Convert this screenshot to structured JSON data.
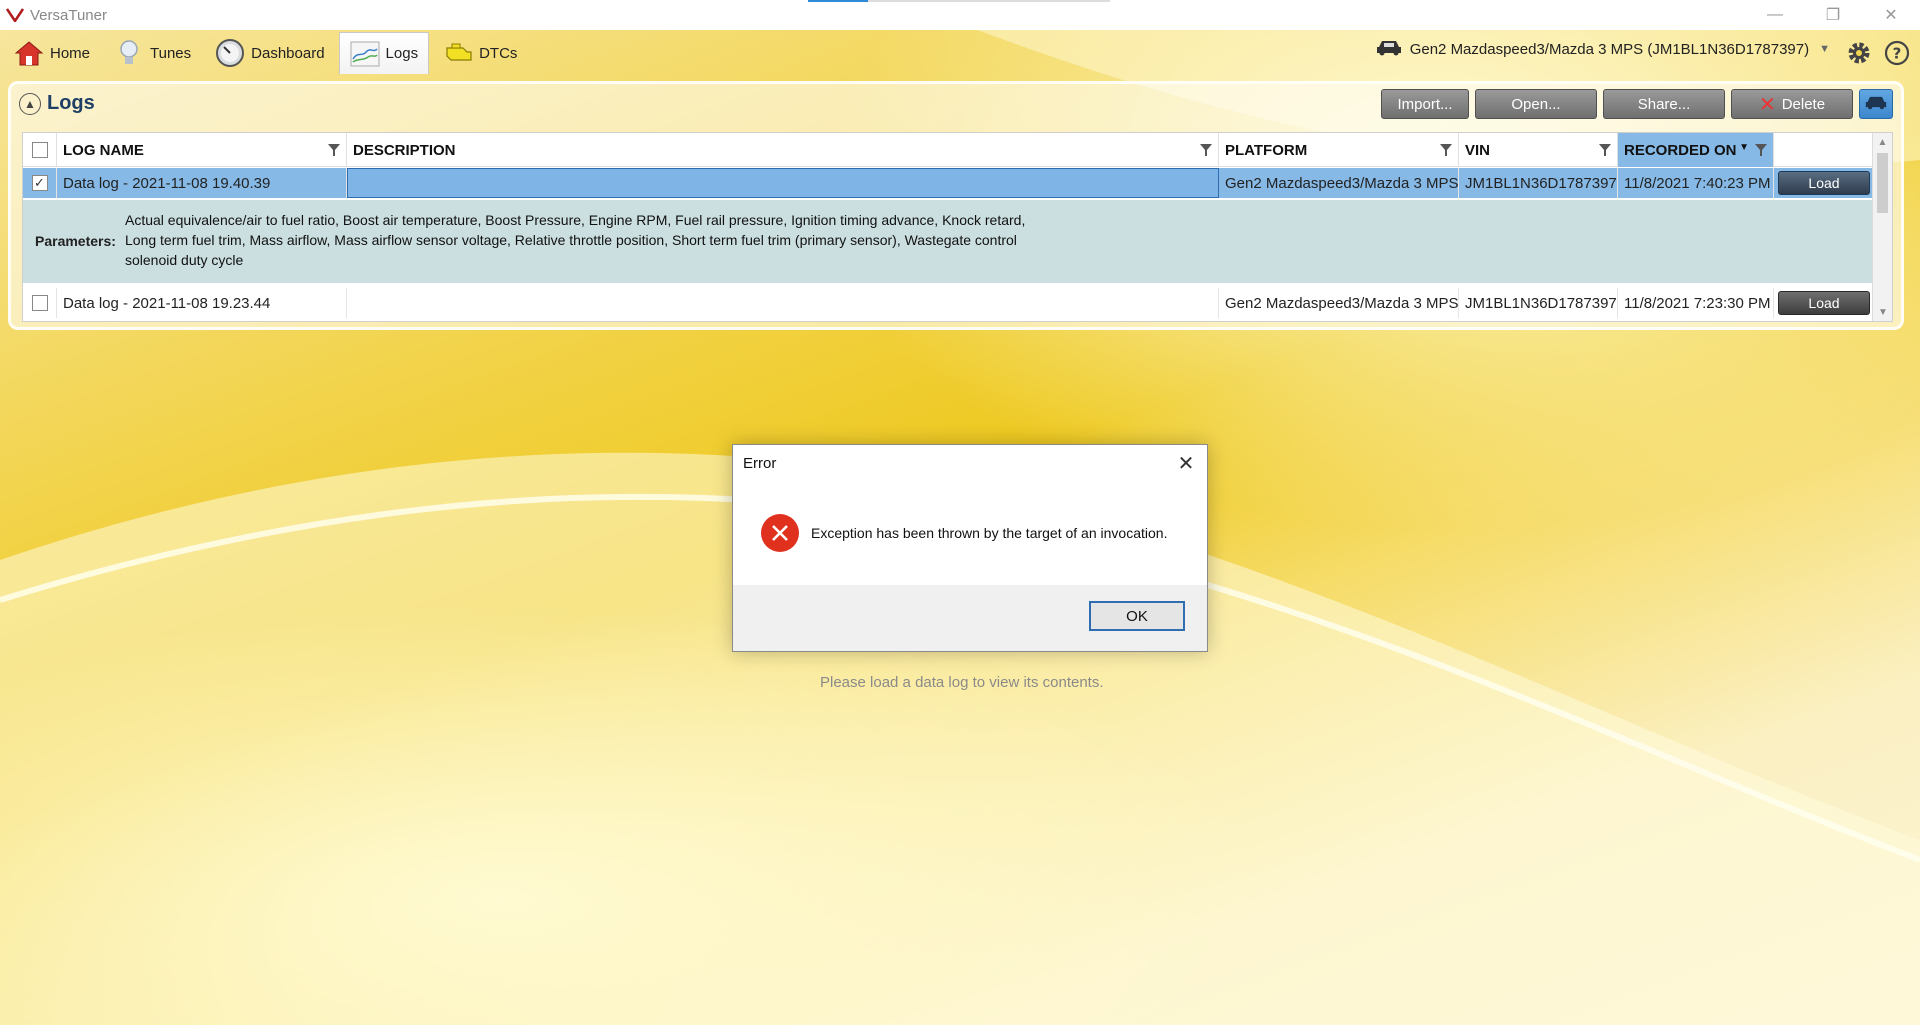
{
  "app": {
    "title": "VersaTuner",
    "window_controls": {
      "minimize": "—",
      "restore": "❐",
      "close": "✕"
    }
  },
  "nav": {
    "tabs": [
      {
        "label": "Home",
        "icon": "home-icon"
      },
      {
        "label": "Tunes",
        "icon": "lightbulb-icon"
      },
      {
        "label": "Dashboard",
        "icon": "gauge-icon"
      },
      {
        "label": "Logs",
        "icon": "chart-icon",
        "active": true
      },
      {
        "label": "DTCs",
        "icon": "engine-icon"
      }
    ],
    "vehicle": "Gen2 Mazdaspeed3/Mazda 3 MPS (JM1BL1N36D1787397)",
    "settings_icon": "gear-icon",
    "help_icon": "help-icon"
  },
  "logs": {
    "title": "Logs",
    "toolbar": {
      "import": "Import...",
      "open": "Open...",
      "share": "Share...",
      "delete": "Delete"
    },
    "columns": {
      "log_name": "LOG NAME",
      "description": "DESCRIPTION",
      "platform": "PLATFORM",
      "vin": "VIN",
      "recorded_on": "RECORDED ON"
    },
    "rows": [
      {
        "checked": "✓",
        "log_name": "Data log - 2021-11-08 19.40.39",
        "description": "",
        "platform": "Gen2 Mazdaspeed3/Mazda 3 MPS",
        "vin": "JM1BL1N36D1787397",
        "recorded_on": "11/8/2021 7:40:23 PM",
        "load": "Load"
      },
      {
        "checked": "",
        "log_name": "Data log - 2021-11-08 19.23.44",
        "description": "",
        "platform": "Gen2 Mazdaspeed3/Mazda 3 MPS",
        "vin": "JM1BL1N36D1787397",
        "recorded_on": "11/8/2021 7:23:30 PM",
        "load": "Load"
      }
    ],
    "parameters_label": "Parameters:",
    "parameters_text": "Actual equivalence/air to fuel ratio, Boost air temperature, Boost Pressure, Engine RPM, Fuel rail pressure, Ignition timing advance, Knock retard, Long term fuel trim, Mass airflow, Mass airflow sensor voltage, Relative throttle position, Short term fuel trim (primary sensor), Wastegate control solenoid duty cycle"
  },
  "empty_state": "Please load a data log to view its contents.",
  "dialog": {
    "title": "Error",
    "message": "Exception has been thrown by the target of an invocation.",
    "ok": "OK"
  }
}
